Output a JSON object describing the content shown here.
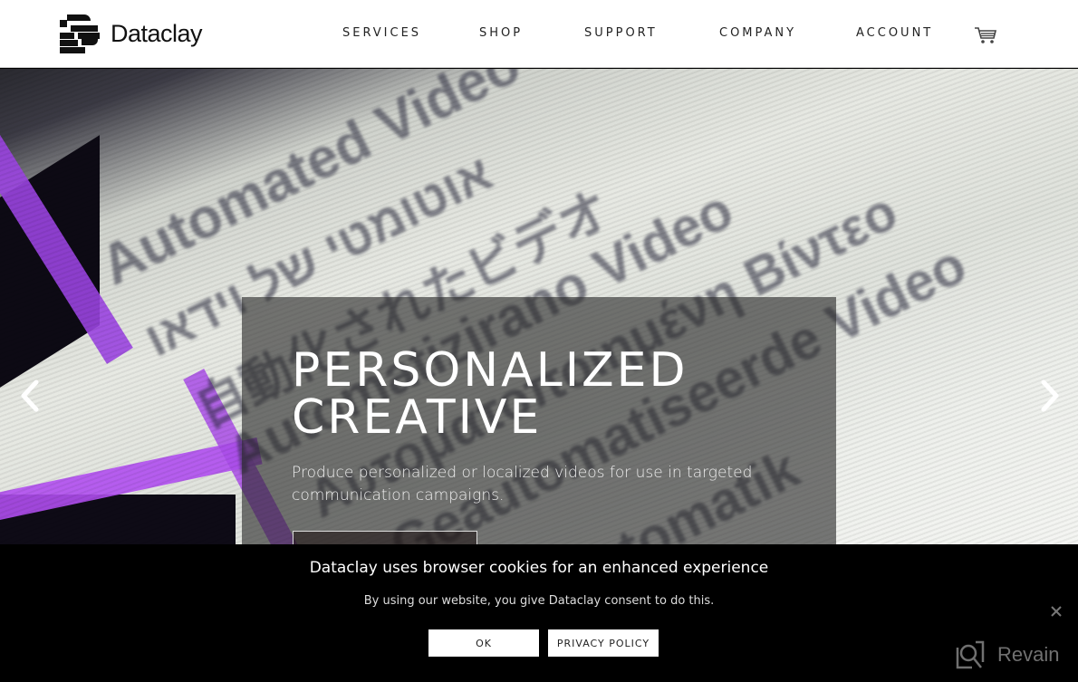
{
  "brand": {
    "name": "Dataclay",
    "logo_icon": "dataclay-striped-d-logo"
  },
  "nav": {
    "items": [
      {
        "label": "SERVICES"
      },
      {
        "label": "SHOP"
      },
      {
        "label": "SUPPORT"
      },
      {
        "label": "COMPANY"
      },
      {
        "label": "ACCOUNT"
      }
    ],
    "cart_icon": "shopping-cart-icon"
  },
  "hero": {
    "background_words": [
      "Automated Video",
      "אוטומטי של וידאו",
      "自動化されたビデオ",
      "Automatizirano Video",
      "Αυτοματοποιημένη Βίντεο",
      "Geautomatiseerde Video",
      "Automatik"
    ],
    "slide": {
      "title_line1": "PERSONALIZED",
      "title_line2": "CREATIVE",
      "description": "Produce personalized or localized videos for use in targeted communication campaigns."
    },
    "prev_icon": "chevron-left-icon",
    "next_icon": "chevron-right-icon"
  },
  "cookie_banner": {
    "title": "Dataclay uses browser cookies for an enhanced experience",
    "subtitle": "By using our website, you give Dataclay consent to do this.",
    "ok_label": "OK",
    "privacy_label": "PRIVACY POLICY",
    "close_icon": "close-icon"
  },
  "watermark": {
    "label": "Revain"
  },
  "colors": {
    "header_bg": "#ffffff",
    "cookie_bg": "#000000",
    "accent_purple": "#9a44e0"
  }
}
